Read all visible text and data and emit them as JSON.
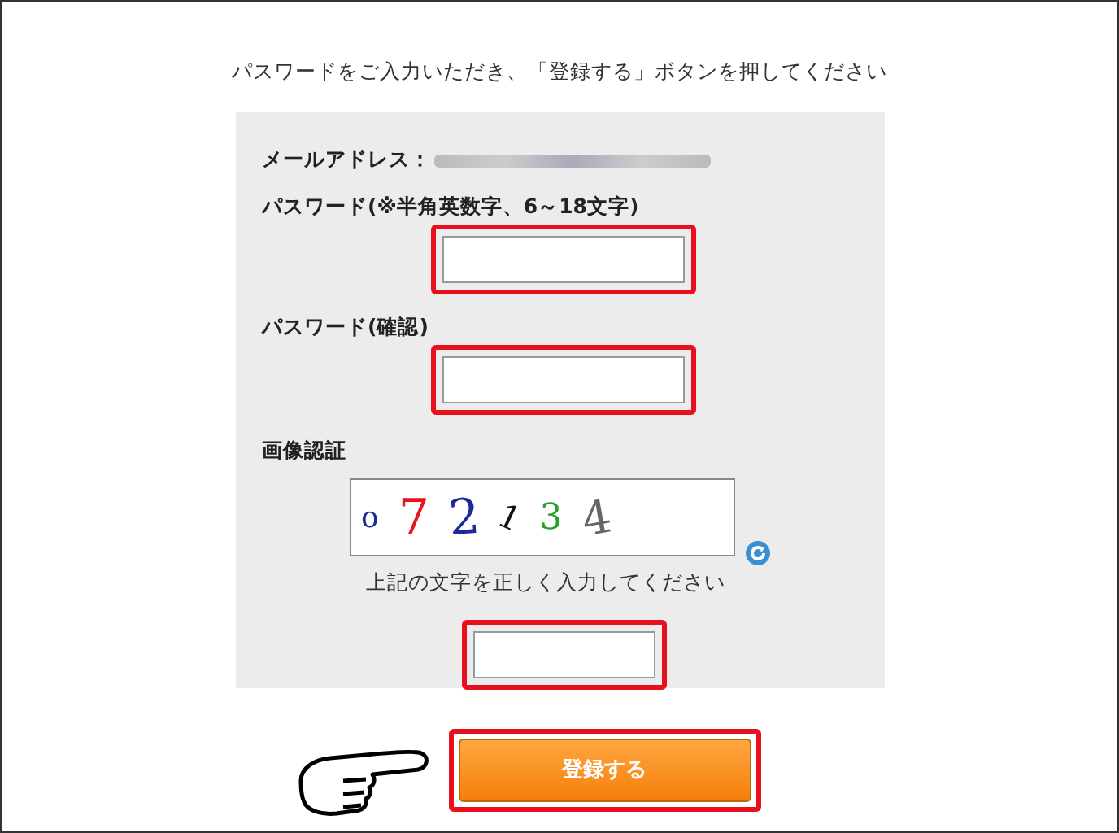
{
  "instruction": "パスワードをご入力いただき、「登録する」ボタンを押してください",
  "email": {
    "label": "メールアドレス：",
    "blurred": true
  },
  "password": {
    "label": "パスワード(※半角英数字、6～18文字)",
    "highlighted": true
  },
  "password_confirm": {
    "label": "パスワード(確認)",
    "highlighted": true
  },
  "captcha": {
    "label": "画像認証",
    "characters": [
      {
        "char": "o",
        "color": "#1a2a9a"
      },
      {
        "char": "7",
        "color": "#e8141c"
      },
      {
        "char": "2",
        "color": "#1a2a9a"
      },
      {
        "char": "1",
        "color": "#111111"
      },
      {
        "char": "3",
        "color": "#2aa02a"
      },
      {
        "char": "4",
        "color": "#666666"
      }
    ],
    "hint": "上記の文字を正しく入力してください",
    "highlighted": true
  },
  "submit": {
    "label": "登録する",
    "highlighted": true
  }
}
